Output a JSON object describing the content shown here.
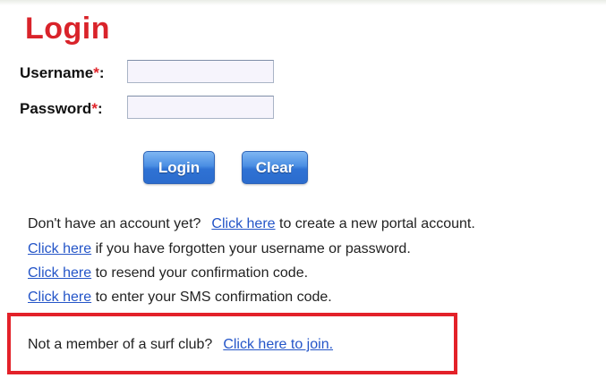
{
  "page": {
    "title": "Login"
  },
  "form": {
    "username_label": "Username",
    "password_label": "Password",
    "required_marker": "*",
    "label_suffix": ":",
    "username_value": "",
    "password_value": ""
  },
  "buttons": {
    "login_label": "Login",
    "clear_label": "Clear"
  },
  "help_links": {
    "create_prefix": "Don't have an account yet?",
    "create_link": "Click here",
    "create_suffix": " to create a new portal account.",
    "forgot_link": "Click here",
    "forgot_suffix": " if you have forgotten your username or password.",
    "resend_link": "Click here",
    "resend_suffix": " to resend your confirmation code.",
    "sms_link": "Click here",
    "sms_suffix": " to enter your SMS confirmation code."
  },
  "join_box": {
    "prefix": "Not a member of a surf club?",
    "link": "Click here to join.",
    "border_color": "#e32129"
  },
  "colors": {
    "title": "#d9232a",
    "link": "#2455c8",
    "button": "#3a7fdc",
    "required": "#e0252b"
  }
}
